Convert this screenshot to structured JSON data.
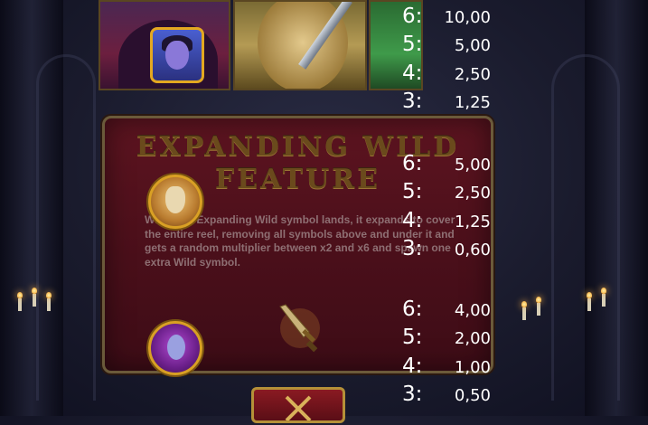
{
  "feature": {
    "title_line1": "EXPANDING WILD",
    "title_line2": "FEATURE",
    "description": "When the Expanding Wild symbol lands, it expands to cover the entire reel, removing all symbols above and under it and gets a random multiplier between x2 and x6 and spawn one extra Wild symbol."
  },
  "paytable": [
    {
      "symbol": "vampire",
      "rows": [
        {
          "count": "6:",
          "value": "10,00"
        },
        {
          "count": "5:",
          "value": "5,00"
        },
        {
          "count": "4:",
          "value": "2,50"
        },
        {
          "count": "3:",
          "value": "1,25"
        }
      ]
    },
    {
      "symbol": "lion",
      "rows": [
        {
          "count": "6:",
          "value": "5,00"
        },
        {
          "count": "5:",
          "value": "2,50"
        },
        {
          "count": "4:",
          "value": "1,25"
        },
        {
          "count": "3:",
          "value": "0,60"
        }
      ]
    },
    {
      "symbol": "purple-creature",
      "rows": [
        {
          "count": "6:",
          "value": "4,00"
        },
        {
          "count": "5:",
          "value": "2,00"
        },
        {
          "count": "4:",
          "value": "1,00"
        },
        {
          "count": "3:",
          "value": "0,50"
        }
      ]
    }
  ],
  "icons": {
    "vampire": "vampire-symbol-icon",
    "lion": "lion-symbol-icon",
    "purple": "purple-creature-symbol-icon",
    "dagger": "dagger-icon",
    "close": "close-x-icon"
  },
  "colors": {
    "panel": "#4a0f1a",
    "gold": "#d9a024",
    "title": "#6a4a1c"
  }
}
